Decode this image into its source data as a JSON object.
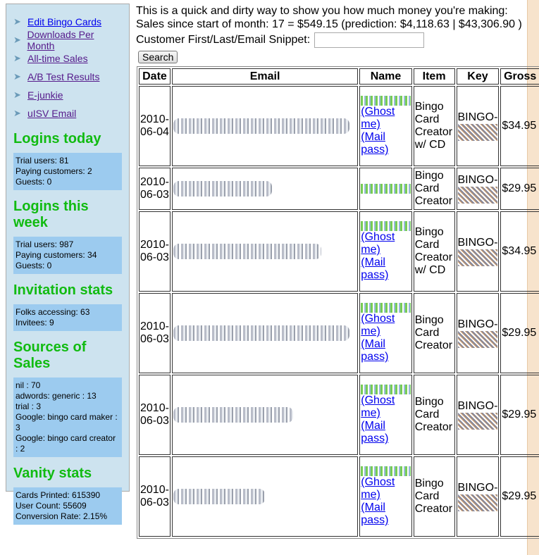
{
  "sidebar": {
    "links": [
      "Edit Bingo Cards",
      "Downloads Per Month",
      "All-time Sales",
      "A/B Test Results",
      "E-junkie",
      "uISV Email"
    ],
    "sections": [
      {
        "title": "Logins today",
        "lines": [
          "Trial users: 81",
          "Paying customers: 2",
          "Guests: 0"
        ]
      },
      {
        "title": "Logins this week",
        "lines": [
          "Trial users: 987",
          "Paying customers: 34",
          "Guests: 0"
        ]
      },
      {
        "title": "Invitation stats",
        "lines": [
          "Folks accessing: 63",
          "Invitees: 9"
        ]
      },
      {
        "title": "Sources of Sales",
        "lines": [
          "nil : 70",
          "adwords: generic : 13",
          "trial : 3",
          "Google: bingo card maker : 3",
          "Google: bingo card creator : 2"
        ]
      },
      {
        "title": "Vanity stats",
        "lines": [
          "Cards Printed: 615390",
          "User Count: 55609",
          "Conversion Rate: 2.15%"
        ]
      }
    ]
  },
  "main": {
    "intro": "This is a quick and dirty way to show you how much money you're making:",
    "sales": "Sales since start of month: 17 = $549.15 (prediction: $4,118.63 | $43,306.90 )",
    "search_label": "Customer First/Last/Email Snippet:",
    "search_value": "",
    "search_button": "Search"
  },
  "table": {
    "headers": [
      "Date",
      "Email",
      "Name",
      "Item",
      "Key",
      "Gross"
    ],
    "ghost": "(Ghost me)",
    "mail": "(Mail pass)",
    "key_prefix": "BINGO-",
    "rows": [
      {
        "date": "2010-06-04",
        "item": "Bingo Card Creator w/ CD",
        "gross": "$34.95",
        "links": true
      },
      {
        "date": "2010-06-03",
        "item": "Bingo Card Creator",
        "gross": "$29.95",
        "links": false
      },
      {
        "date": "2010-06-03",
        "item": "Bingo Card Creator w/ CD",
        "gross": "$34.95",
        "links": true
      },
      {
        "date": "2010-06-03",
        "item": "Bingo Card Creator",
        "gross": "$29.95",
        "links": true
      },
      {
        "date": "2010-06-03",
        "item": "Bingo Card Creator",
        "gross": "$29.95",
        "links": true
      },
      {
        "date": "2010-06-03",
        "item": "Bingo Card Creator",
        "gross": "$29.95",
        "links": true
      }
    ]
  }
}
